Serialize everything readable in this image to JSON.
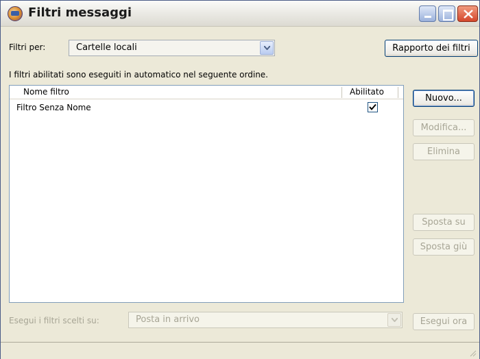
{
  "window": {
    "title": "Filtri messaggi",
    "icon": "thunderbird-icon"
  },
  "filter_for": {
    "label": "Filtri per:",
    "value": "Cartelle locali"
  },
  "buttons": {
    "report": "Rapporto dei filtri",
    "new": "Nuovo...",
    "edit": "Modifica...",
    "delete": "Elimina",
    "move_up": "Sposta su",
    "move_down": "Sposta giù",
    "run_now": "Esegui ora"
  },
  "description": "I filtri abilitati sono eseguiti in automatico nel seguente ordine.",
  "list": {
    "columns": {
      "name": "Nome filtro",
      "enabled": "Abilitato"
    },
    "rows": [
      {
        "name": "Filtro Senza Nome",
        "enabled": true
      }
    ]
  },
  "run_on": {
    "label": "Esegui i filtri scelti su:",
    "value": "Posta in arrivo"
  }
}
